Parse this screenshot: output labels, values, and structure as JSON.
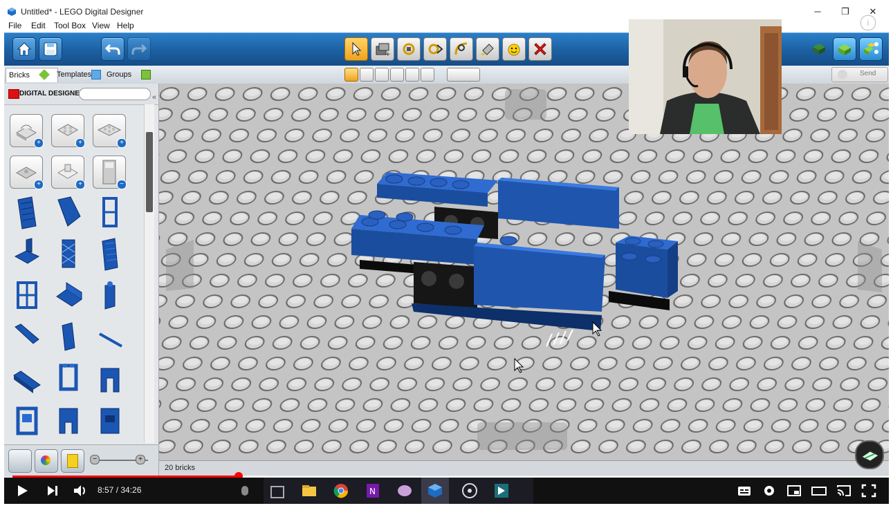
{
  "window": {
    "title": "Untitled* - LEGO Digital Designer",
    "minimize": "─",
    "restore": "❐",
    "close": "✕"
  },
  "menu": [
    "File",
    "Edit",
    "Tool Box",
    "View",
    "Help"
  ],
  "tabs": {
    "bricks": "Bricks",
    "templates": "Templates",
    "groups": "Groups"
  },
  "brand": "DIGITAL DESIGNER",
  "send_label": "Send",
  "status": {
    "brick_count": "20 bricks"
  },
  "player": {
    "time": "8:57 / 34:26",
    "progress_fraction": 0.258
  },
  "colors": {
    "brick_blue": "#1b4d9e",
    "toolbar_blue": "#1b5fa0",
    "accent_orange": "#f0a21c"
  },
  "icons": {
    "toolbar_left": [
      "home-icon",
      "save-icon",
      "undo-icon",
      "redo-icon"
    ],
    "tools": [
      "select-icon",
      "clone-icon",
      "hinge-icon",
      "hinge-align-icon",
      "flex-icon",
      "paint-icon",
      "decorate-icon",
      "delete-icon"
    ],
    "view": [
      "build-mode-icon",
      "view-mode-icon",
      "building-guide-icon"
    ]
  },
  "player_icons": [
    "play-icon",
    "next-icon",
    "volume-icon",
    "subtitles-icon",
    "settings-icon",
    "miniplayer-icon",
    "theater-icon",
    "cast-icon",
    "fullscreen-icon"
  ]
}
